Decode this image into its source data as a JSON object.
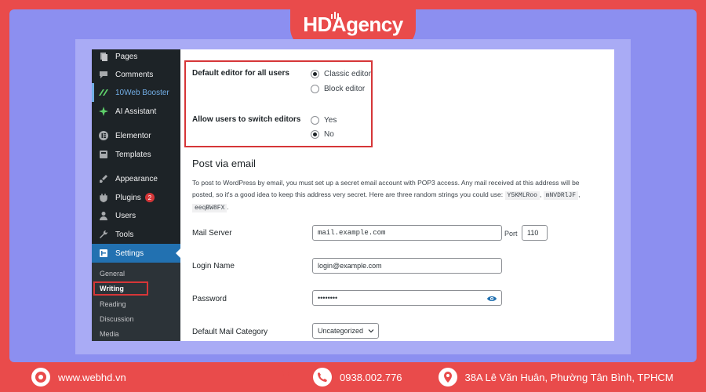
{
  "brand": {
    "logo_text": "HDAgency"
  },
  "sidebar": {
    "items": [
      {
        "label": "Pages",
        "icon": "pages-icon"
      },
      {
        "label": "Comments",
        "icon": "comments-icon"
      },
      {
        "label": "10Web Booster",
        "icon": "booster-icon"
      },
      {
        "label": "AI Assistant",
        "icon": "ai-sparkle-icon"
      },
      {
        "label": "Elementor",
        "icon": "elementor-icon"
      },
      {
        "label": "Templates",
        "icon": "templates-icon"
      },
      {
        "label": "Appearance",
        "icon": "appearance-icon"
      },
      {
        "label": "Plugins",
        "icon": "plugins-icon",
        "badge": "2"
      },
      {
        "label": "Users",
        "icon": "users-icon"
      },
      {
        "label": "Tools",
        "icon": "tools-icon"
      },
      {
        "label": "Settings",
        "icon": "settings-icon"
      }
    ],
    "submenu": [
      "General",
      "Writing",
      "Reading",
      "Discussion",
      "Media"
    ]
  },
  "editor": {
    "default_editor_label": "Default editor for all users",
    "classic_label": "Classic editor",
    "block_label": "Block editor",
    "switch_label": "Allow users to switch editors",
    "yes_label": "Yes",
    "no_label": "No"
  },
  "post_via_email": {
    "title": "Post via email",
    "desc_1": "To post to WordPress by email, you must set up a secret email account with POP3 access. Any mail received at this address will be posted, so it's a good idea to keep this address very secret. Here are three random strings you could use:",
    "codes": [
      "Y5KMLRoo",
      "mNVDRlJF",
      "eeqBW8FX"
    ],
    "mail_server_label": "Mail Server",
    "mail_server_value": "mail.example.com",
    "port_label": "Port",
    "port_value": "110",
    "login_label": "Login Name",
    "login_value": "login@example.com",
    "password_label": "Password",
    "password_value": "••••••••",
    "category_label": "Default Mail Category",
    "category_value": "Uncategorized"
  },
  "footer": {
    "website": "www.webhd.vn",
    "phone": "0938.002.776",
    "address": "38A Lê Văn Huân, Phường Tân Bình, TPHCM"
  },
  "colors": {
    "accent_red": "#e94b4b",
    "frame_purple": "#8c8ff0",
    "wp_sidebar": "#1d2327",
    "wp_active": "#2271b1"
  }
}
